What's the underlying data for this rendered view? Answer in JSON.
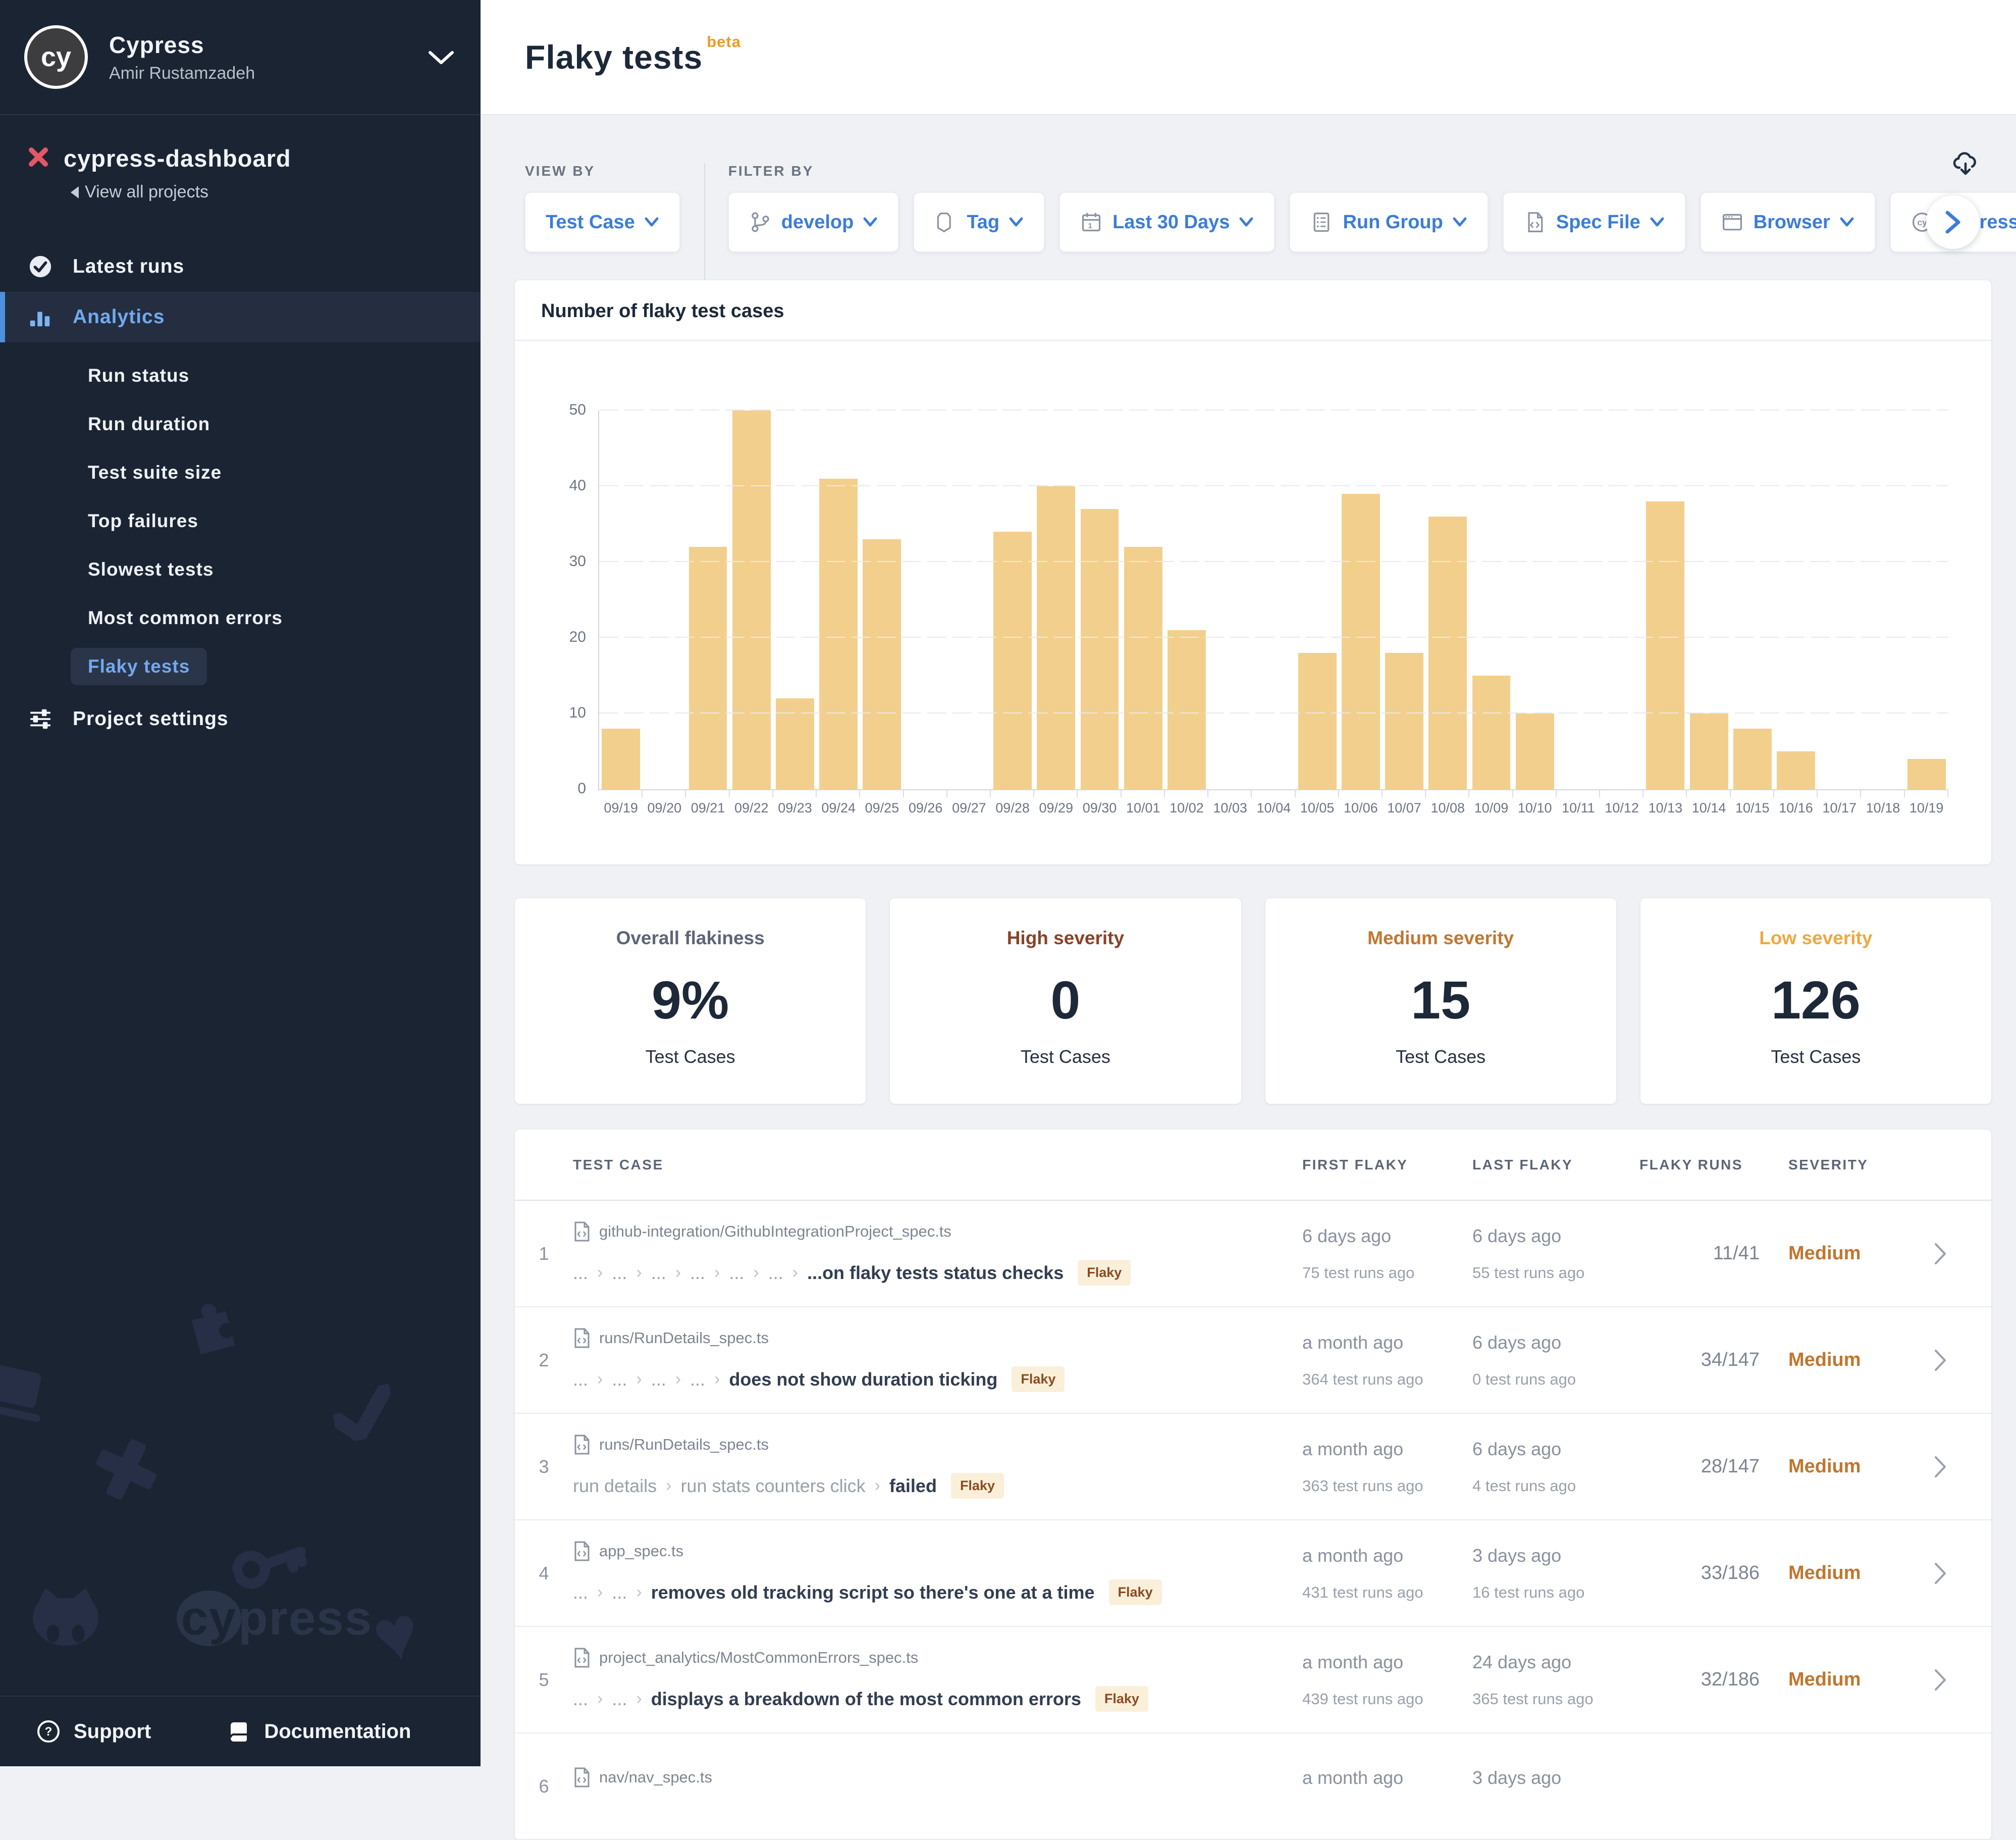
{
  "colors": {
    "accent_blue": "#3b7dd8",
    "bar": "#f3cf8d",
    "severity_medium": "#c0762f",
    "badge_bg": "#faf0da",
    "badge_text": "#8c4a23",
    "beta": "#ee9b22"
  },
  "sidebar": {
    "org": {
      "initials": "cy",
      "name": "Cypress",
      "user": "Amir Rustamzadeh"
    },
    "project": {
      "name": "cypress-dashboard",
      "back_link": "View all projects"
    },
    "nav": [
      {
        "label": "Latest runs",
        "icon": "check-circle-icon"
      },
      {
        "label": "Analytics",
        "icon": "bar-chart-icon"
      }
    ],
    "analytics_items": [
      "Run status",
      "Run duration",
      "Test suite size",
      "Top failures",
      "Slowest tests",
      "Most common errors",
      "Flaky tests"
    ],
    "active_item": "Flaky tests",
    "settings_label": "Project settings",
    "watermark_word": "press",
    "watermark_cy": "cy",
    "footer": [
      {
        "label": "Support",
        "icon": "question-circle-icon"
      },
      {
        "label": "Documentation",
        "icon": "book-icon"
      }
    ]
  },
  "header": {
    "title": "Flaky tests",
    "badge": "beta"
  },
  "filters": {
    "view_by_label": "VIEW BY",
    "filter_by_label": "FILTER BY",
    "view_by": [
      {
        "label": "Test Case",
        "icon": null
      }
    ],
    "filter_by": [
      {
        "label": "develop",
        "icon": "git-branch-icon"
      },
      {
        "label": "Tag",
        "icon": "tag-icon"
      },
      {
        "label": "Last 30 Days",
        "icon": "calendar-icon"
      },
      {
        "label": "Run Group",
        "icon": "run-group-icon"
      },
      {
        "label": "Spec File",
        "icon": "spec-file-icon"
      },
      {
        "label": "Browser",
        "icon": "browser-icon"
      },
      {
        "label": "Cypress V",
        "icon": "cypress-circle-icon",
        "truncated": true
      }
    ]
  },
  "chart_data": {
    "type": "bar",
    "title": "Number of flaky test cases",
    "categories": [
      "09/19",
      "09/20",
      "09/21",
      "09/22",
      "09/23",
      "09/24",
      "09/25",
      "09/26",
      "09/27",
      "09/28",
      "09/29",
      "09/30",
      "10/01",
      "10/02",
      "10/03",
      "10/04",
      "10/05",
      "10/06",
      "10/07",
      "10/08",
      "10/09",
      "10/10",
      "10/11",
      "10/12",
      "10/13",
      "10/14",
      "10/15",
      "10/16",
      "10/17",
      "10/18",
      "10/19"
    ],
    "values": [
      8,
      0,
      32,
      50,
      12,
      41,
      33,
      0,
      0,
      34,
      40,
      37,
      32,
      21,
      0,
      0,
      18,
      39,
      18,
      36,
      15,
      10,
      0,
      0,
      38,
      10,
      8,
      5,
      0,
      0,
      4
    ],
    "xlabel": "",
    "ylabel": "",
    "ylim": [
      0,
      50
    ],
    "yticks": [
      0,
      10,
      20,
      30,
      40,
      50
    ],
    "grid": true,
    "legend": false,
    "bar_color": "#f3cf8d"
  },
  "stats": [
    {
      "title": "Overall flakiness",
      "value": "9%",
      "caption": "Test Cases",
      "color": "#5d6577"
    },
    {
      "title": "High severity",
      "value": "0",
      "caption": "Test Cases",
      "color": "#8a4227"
    },
    {
      "title": "Medium severity",
      "value": "15",
      "caption": "Test Cases",
      "color": "#c2762f"
    },
    {
      "title": "Low severity",
      "value": "126",
      "caption": "Test Cases",
      "color": "#eda83f"
    }
  ],
  "table": {
    "columns": [
      "TEST CASE",
      "FIRST FLAKY",
      "LAST FLAKY",
      "FLAKY RUNS",
      "SEVERITY"
    ],
    "rows": [
      {
        "num": "1",
        "spec": "github-integration/GithubIntegrationProject_spec.ts",
        "crumbs": [
          "...",
          "...",
          "...",
          "...",
          "...",
          "..."
        ],
        "title": "...on flaky tests status checks",
        "badge": "Flaky",
        "first": "6 days ago",
        "first_sub": "75 test runs ago",
        "last": "6 days ago",
        "last_sub": "55 test runs ago",
        "runs": "11/41",
        "severity": "Medium"
      },
      {
        "num": "2",
        "spec": "runs/RunDetails_spec.ts",
        "crumbs": [
          "...",
          "...",
          "...",
          "..."
        ],
        "title": "does not show duration ticking",
        "badge": "Flaky",
        "first": "a month ago",
        "first_sub": "364 test runs ago",
        "last": "6 days ago",
        "last_sub": "0 test runs ago",
        "runs": "34/147",
        "severity": "Medium"
      },
      {
        "num": "3",
        "spec": "runs/RunDetails_spec.ts",
        "crumbs": [
          "run details",
          "run stats counters click"
        ],
        "title": "failed",
        "badge": "Flaky",
        "first": "a month ago",
        "first_sub": "363 test runs ago",
        "last": "6 days ago",
        "last_sub": "4 test runs ago",
        "runs": "28/147",
        "severity": "Medium"
      },
      {
        "num": "4",
        "spec": "app_spec.ts",
        "crumbs": [
          "...",
          "..."
        ],
        "title": "removes old tracking script so there's one at a time",
        "badge": "Flaky",
        "first": "a month ago",
        "first_sub": "431 test runs ago",
        "last": "3 days ago",
        "last_sub": "16 test runs ago",
        "runs": "33/186",
        "severity": "Medium"
      },
      {
        "num": "5",
        "spec": "project_analytics/MostCommonErrors_spec.ts",
        "crumbs": [
          "...",
          "..."
        ],
        "title": "displays a breakdown of the most common errors",
        "badge": "Flaky",
        "first": "a month ago",
        "first_sub": "439 test runs ago",
        "last": "24 days ago",
        "last_sub": "365 test runs ago",
        "runs": "32/186",
        "severity": "Medium"
      },
      {
        "num": "6",
        "spec": "nav/nav_spec.ts",
        "crumbs": [],
        "title": "",
        "badge": "",
        "first": "a month ago",
        "first_sub": "",
        "last": "3 days ago",
        "last_sub": "",
        "runs": "",
        "severity": ""
      }
    ]
  }
}
